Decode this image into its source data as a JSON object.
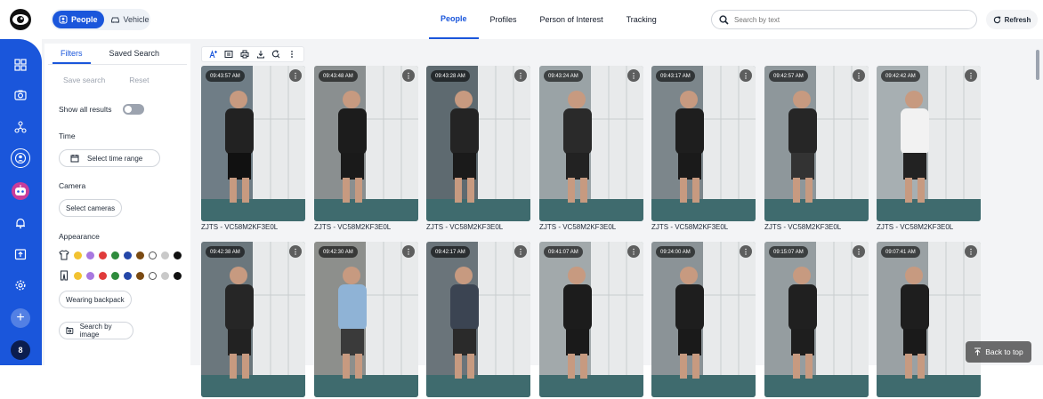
{
  "header": {
    "segment": [
      {
        "label": "People",
        "active": true
      },
      {
        "label": "Vehicle",
        "active": false
      }
    ],
    "tabs": [
      {
        "label": "People",
        "active": true
      },
      {
        "label": "Profiles",
        "active": false
      },
      {
        "label": "Person of Interest",
        "active": false
      },
      {
        "label": "Tracking",
        "active": false
      }
    ],
    "search_placeholder": "Search by text",
    "refresh_label": "Refresh"
  },
  "rail": {
    "icons": [
      "dashboard-icon",
      "camera-icon",
      "network-icon",
      "person-icon",
      "robot-icon",
      "bell-icon",
      "export-icon",
      "settings-icon"
    ],
    "add_label": "+",
    "badge_count": "8"
  },
  "filters": {
    "tabs": [
      {
        "label": "Filters",
        "active": true
      },
      {
        "label": "Saved Search",
        "active": false
      }
    ],
    "save_search": "Save search",
    "reset": "Reset",
    "show_all_results": "Show all results",
    "time_heading": "Time",
    "time_button": "Select time range",
    "camera_heading": "Camera",
    "camera_button": "Select cameras",
    "appearance_heading": "Appearance",
    "colors": [
      "#f2c230",
      "#a878e0",
      "#e03b3b",
      "#2e8b3c",
      "#2447a8",
      "#7a4a12",
      "#ffffff",
      "#c9c9c9",
      "#111111"
    ],
    "backpack_button": "Wearing backpack",
    "image_search_button": "Search by image"
  },
  "toolbar": {
    "icons": [
      "text-format-icon",
      "list-icon",
      "print-icon",
      "download-icon",
      "search-refresh-icon",
      "more-vert-icon"
    ]
  },
  "results": [
    {
      "time": "09:43:57 AM",
      "caption": "ZJTS - VC58M2KF3E0L",
      "shirt": "#222",
      "pants": "#111",
      "scene": "#6f7d86"
    },
    {
      "time": "09:43:48 AM",
      "caption": "ZJTS - VC58M2KF3E0L",
      "shirt": "#1c1c1c",
      "pants": "#1a1a1a",
      "scene": "#8a8f90"
    },
    {
      "time": "09:43:28 AM",
      "caption": "ZJTS - VC58M2KF3E0L",
      "shirt": "#242424",
      "pants": "#1a1a1a",
      "scene": "#5e6a70"
    },
    {
      "time": "09:43:24 AM",
      "caption": "ZJTS - VC58M2KF3E0L",
      "shirt": "#2a2a2a",
      "pants": "#222",
      "scene": "#9aa3a6"
    },
    {
      "time": "09:43:17 AM",
      "caption": "ZJTS - VC58M2KF3E0L",
      "shirt": "#1e1e1e",
      "pants": "#1a1a1a",
      "scene": "#7c868b"
    },
    {
      "time": "09:42:57 AM",
      "caption": "ZJTS - VC58M2KF3E0L",
      "shirt": "#262626",
      "pants": "#333",
      "scene": "#8e979b"
    },
    {
      "time": "09:42:42 AM",
      "caption": "ZJTS - VC58M2KF3E0L",
      "shirt": "#f2f2f2",
      "pants": "#222",
      "scene": "#a7afb2"
    },
    {
      "time": "09:42:38 AM",
      "caption": "",
      "shirt": "#262626",
      "pants": "#222",
      "scene": "#6b777d"
    },
    {
      "time": "09:42:30 AM",
      "caption": "",
      "shirt": "#8fb3d6",
      "pants": "#3a3a3a",
      "scene": "#8d8f8c"
    },
    {
      "time": "09:42:17 AM",
      "caption": "",
      "shirt": "#3b4452",
      "pants": "#2a2a2a",
      "scene": "#6a747a"
    },
    {
      "time": "09:41:07 AM",
      "caption": "",
      "shirt": "#1c1c1c",
      "pants": "#1a1a1a",
      "scene": "#a2a9ab"
    },
    {
      "time": "09:24:00 AM",
      "caption": "",
      "shirt": "#1e1e1e",
      "pants": "#1a1a1a",
      "scene": "#8b9397"
    },
    {
      "time": "09:15:07 AM",
      "caption": "",
      "shirt": "#202020",
      "pants": "#1e1e1e",
      "scene": "#959da0"
    },
    {
      "time": "09:07:41 AM",
      "caption": "",
      "shirt": "#1e1e1e",
      "pants": "#1a1a1a",
      "scene": "#9aa1a4"
    }
  ],
  "back_to_top": "Back to top"
}
